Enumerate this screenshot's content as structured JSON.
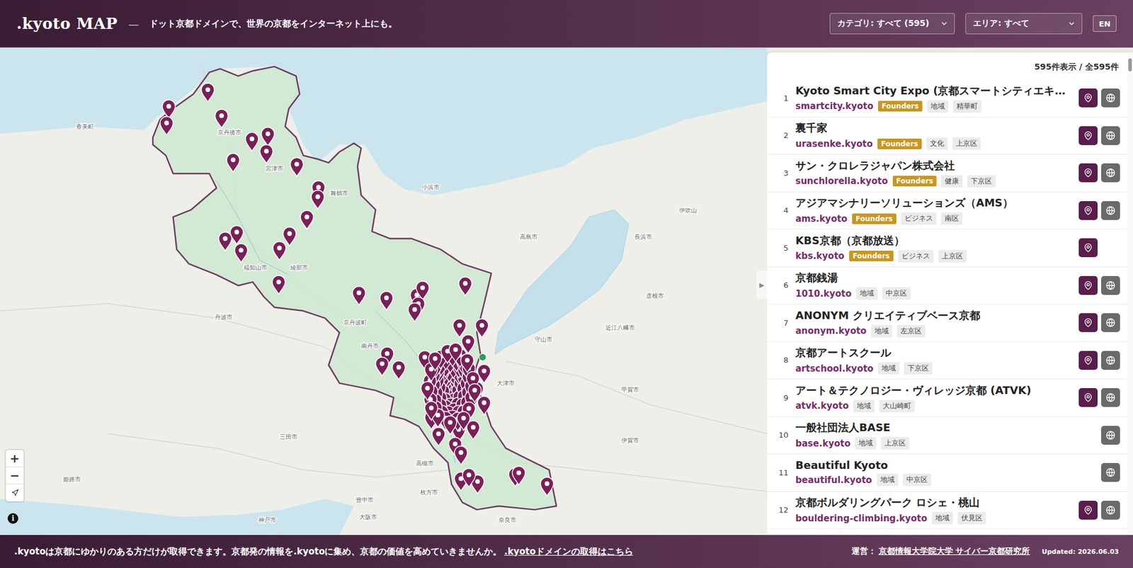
{
  "header": {
    "logo": ".kyoto MAP",
    "separator": "—",
    "tagline": "ドット京都ドメインで、世界の京都をインターネット上にも。",
    "category_select": "カテゴリ: すべて (595)",
    "area_select": "エリア: すべて",
    "language_button": "EN"
  },
  "map": {
    "labels": [
      "京丹後市",
      "宮津市",
      "舞鶴市",
      "福知山市",
      "綾部市",
      "京丹波町",
      "南丹市",
      "大津市",
      "守山市",
      "高槻市",
      "枚方市",
      "豊中市",
      "大阪市",
      "神戸市",
      "姫路市",
      "三田市",
      "丹波市",
      "香美町",
      "小浜市",
      "高島市",
      "長浜市",
      "彦根市",
      "近江八幡市",
      "甲賀市",
      "伊賀市",
      "奈良市",
      "伊吹山"
    ],
    "controls": {
      "zoom_in": "+",
      "zoom_out": "−",
      "info": "i"
    },
    "panel_toggle": "▶"
  },
  "list": {
    "summary": "595件表示 / 全595件",
    "items": [
      {
        "number": "1",
        "title": "Kyoto Smart City Expo (京都スマートシティエキ…",
        "domain": "smartcity.kyoto",
        "badge": "Founders",
        "category": "地域",
        "area": "精華町",
        "has_pin": true,
        "has_site": true
      },
      {
        "number": "2",
        "title": "裏千家",
        "domain": "urasenke.kyoto",
        "badge": "Founders",
        "category": "文化",
        "area": "上京区",
        "has_pin": true,
        "has_site": true
      },
      {
        "number": "3",
        "title": "サン・クロレラジャパン株式会社",
        "domain": "sunchlorella.kyoto",
        "badge": "Founders",
        "category": "健康",
        "area": "下京区",
        "has_pin": true,
        "has_site": true
      },
      {
        "number": "4",
        "title": "アジアマシナリーソリューションズ（AMS）",
        "domain": "ams.kyoto",
        "badge": "Founders",
        "category": "ビジネス",
        "area": "南区",
        "has_pin": true,
        "has_site": true
      },
      {
        "number": "5",
        "title": "KBS京都（京都放送）",
        "domain": "kbs.kyoto",
        "badge": "Founders",
        "category": "ビジネス",
        "area": "上京区",
        "has_pin": true,
        "has_site": false
      },
      {
        "number": "6",
        "title": "京都銭湯",
        "domain": "1010.kyoto",
        "badge": null,
        "category": "地域",
        "area": "中京区",
        "has_pin": true,
        "has_site": true
      },
      {
        "number": "7",
        "title": "ANONYM クリエイティブベース京都",
        "domain": "anonym.kyoto",
        "badge": null,
        "category": "地域",
        "area": "左京区",
        "has_pin": true,
        "has_site": true
      },
      {
        "number": "8",
        "title": "京都アートスクール",
        "domain": "artschool.kyoto",
        "badge": null,
        "category": "地域",
        "area": "下京区",
        "has_pin": true,
        "has_site": true
      },
      {
        "number": "9",
        "title": "アート＆テクノロジー・ヴィレッジ京都 (ATVK)",
        "domain": "atvk.kyoto",
        "badge": null,
        "category": "地域",
        "area": "大山崎町",
        "has_pin": true,
        "has_site": true
      },
      {
        "number": "10",
        "title": "一般社団法人BASE",
        "domain": "base.kyoto",
        "badge": null,
        "category": "地域",
        "area": "上京区",
        "has_pin": false,
        "has_site": true
      },
      {
        "number": "11",
        "title": "Beautiful Kyoto",
        "domain": "beautiful.kyoto",
        "badge": null,
        "category": "地域",
        "area": "中京区",
        "has_pin": false,
        "has_site": true
      },
      {
        "number": "12",
        "title": "京都ボルダリングパーク ロシェ・桃山",
        "domain": "bouldering-climbing.kyoto",
        "badge": null,
        "category": "地域",
        "area": "伏見区",
        "has_pin": true,
        "has_site": true
      }
    ]
  },
  "footer": {
    "message": ".kyotoは京都にゆかりのある方だけが取得できます。京都発の情報を.kyotoに集め、京都の価値を高めていきませんか。",
    "link": ".kyotoドメインの取得はこちら",
    "operator_label": "運営：",
    "operator": "京都情報大学院大学 サイバー京都研究所",
    "updated": "Updated: 2026.06.03"
  }
}
